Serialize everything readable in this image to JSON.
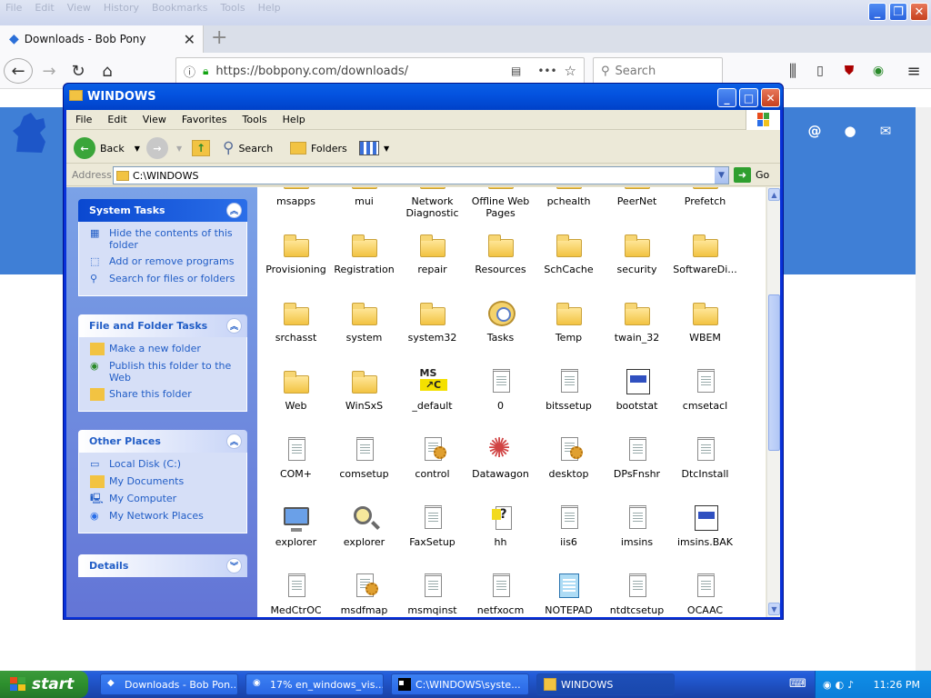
{
  "browser": {
    "menu": [
      "File",
      "Edit",
      "View",
      "History",
      "Bookmarks",
      "Tools",
      "Help"
    ],
    "tab_title": "Downloads - Bob Pony",
    "url": "https://bobpony.com/downloads/",
    "search_placeholder": "Search"
  },
  "window": {
    "title": "WINDOWS",
    "menu": [
      "File",
      "Edit",
      "View",
      "Favorites",
      "Tools",
      "Help"
    ],
    "toolbar": {
      "back": "Back",
      "search": "Search",
      "folders": "Folders"
    },
    "address": {
      "label": "Address",
      "path": "C:\\WINDOWS",
      "go": "Go"
    }
  },
  "task_pane": {
    "system_tasks": {
      "title": "System Tasks",
      "items": [
        "Hide the contents of this folder",
        "Add or remove programs",
        "Search for files or folders"
      ]
    },
    "file_folder_tasks": {
      "title": "File and Folder Tasks",
      "items": [
        "Make a new folder",
        "Publish this folder to the Web",
        "Share this folder"
      ]
    },
    "other_places": {
      "title": "Other Places",
      "items": [
        "Local Disk (C:)",
        "My Documents",
        "My Computer",
        "My Network Places"
      ]
    },
    "details": {
      "title": "Details"
    }
  },
  "files": [
    {
      "name": "msapps",
      "icon": "folder-icon"
    },
    {
      "name": "mui",
      "icon": "folder-icon"
    },
    {
      "name": "Network Diagnostic",
      "icon": "folder-icon"
    },
    {
      "name": "Offline Web Pages",
      "icon": "folder-icon"
    },
    {
      "name": "pchealth",
      "icon": "folder-icon"
    },
    {
      "name": "PeerNet",
      "icon": "folder-icon"
    },
    {
      "name": "Prefetch",
      "icon": "folder-icon"
    },
    {
      "name": "Provisioning",
      "icon": "folder-icon"
    },
    {
      "name": "Registration",
      "icon": "folder-icon"
    },
    {
      "name": "repair",
      "icon": "folder-icon"
    },
    {
      "name": "Resources",
      "icon": "folder-icon"
    },
    {
      "name": "SchCache",
      "icon": "folder-icon"
    },
    {
      "name": "security",
      "icon": "folder-icon"
    },
    {
      "name": "SoftwareDi...",
      "icon": "folder-icon"
    },
    {
      "name": "srchasst",
      "icon": "folder-icon"
    },
    {
      "name": "system",
      "icon": "folder-icon"
    },
    {
      "name": "system32",
      "icon": "folder-icon"
    },
    {
      "name": "Tasks",
      "icon": "tasks-folder-icon"
    },
    {
      "name": "Temp",
      "icon": "folder-icon"
    },
    {
      "name": "twain_32",
      "icon": "folder-icon"
    },
    {
      "name": "WBEM",
      "icon": "folder-icon"
    },
    {
      "name": "Web",
      "icon": "folder-icon"
    },
    {
      "name": "WinSxS",
      "icon": "folder-icon"
    },
    {
      "name": "_default",
      "icon": "msc-shortcut-icon"
    },
    {
      "name": "0",
      "icon": "text-file-icon"
    },
    {
      "name": "bitssetup",
      "icon": "text-file-icon"
    },
    {
      "name": "bootstat",
      "icon": "system-file-icon"
    },
    {
      "name": "cmsetacl",
      "icon": "text-file-icon"
    },
    {
      "name": "COM+",
      "icon": "text-file-icon"
    },
    {
      "name": "comsetup",
      "icon": "text-file-icon"
    },
    {
      "name": "control",
      "icon": "settings-file-icon"
    },
    {
      "name": "Datawagon",
      "icon": "screensaver-icon"
    },
    {
      "name": "desktop",
      "icon": "settings-file-icon"
    },
    {
      "name": "DPsFnshr",
      "icon": "text-file-icon"
    },
    {
      "name": "DtcInstall",
      "icon": "text-file-icon"
    },
    {
      "name": "explorer",
      "icon": "explorer-icon"
    },
    {
      "name": "explorer",
      "icon": "search-explorer-icon"
    },
    {
      "name": "FaxSetup",
      "icon": "text-file-icon"
    },
    {
      "name": "hh",
      "icon": "help-file-icon"
    },
    {
      "name": "iis6",
      "icon": "text-file-icon"
    },
    {
      "name": "imsins",
      "icon": "text-file-icon"
    },
    {
      "name": "imsins.BAK",
      "icon": "system-file-icon"
    },
    {
      "name": "MedCtrOC",
      "icon": "text-file-icon"
    },
    {
      "name": "msdfmap",
      "icon": "settings-file-icon"
    },
    {
      "name": "msmqinst",
      "icon": "text-file-icon"
    },
    {
      "name": "netfxocm",
      "icon": "text-file-icon"
    },
    {
      "name": "NOTEPAD",
      "icon": "notepad-icon"
    },
    {
      "name": "ntdtcsetup",
      "icon": "text-file-icon"
    },
    {
      "name": "OCAAC",
      "icon": "text-file-icon"
    }
  ],
  "taskbar": {
    "start": "start",
    "tasks": [
      "Downloads - Bob Pon...",
      "17% en_windows_vis...",
      "C:\\WINDOWS\\syste...",
      "WINDOWS"
    ],
    "clock": "11:26 PM"
  }
}
